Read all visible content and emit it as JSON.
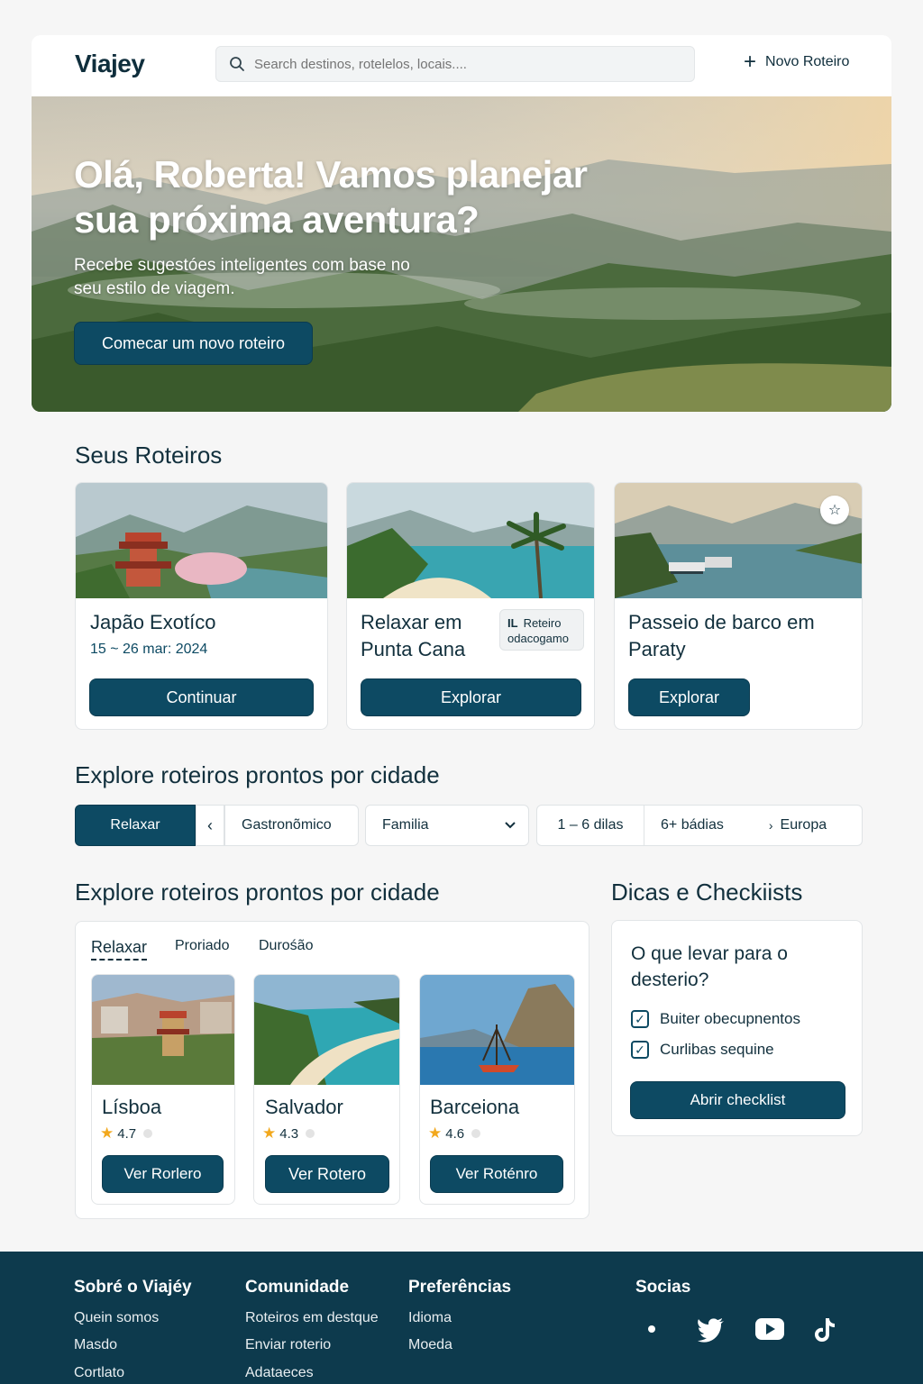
{
  "header": {
    "logo": "Viajey",
    "search_placeholder": "Search destinos, rotelelos, locais....",
    "new_trip": "Novo Roteiro"
  },
  "hero": {
    "title": "Olá, Roberta! Vamos planejar sua próxima aventura?",
    "subtitle": "Recebe sugestóes inteligentes com base no seu estilo de viagem.",
    "cta": "Comecar um novo roteiro"
  },
  "trips": {
    "heading": "Seus Roteiros",
    "items": [
      {
        "title": "Japão Exotíco",
        "date": "15 ~ 26 mar: 2024",
        "action": "Continuar"
      },
      {
        "title": "Relaxar em Punta Cana",
        "tag_line1": "Reteiro",
        "tag_line2": "odacogamo",
        "action": "Explorar"
      },
      {
        "title": "Passeio de barco em Paraty",
        "action": "Explorar"
      }
    ]
  },
  "explore": {
    "heading": "Explore roteiros prontos por cidade",
    "filters": {
      "relax": "Relaxar",
      "prev": "‹",
      "gastro": "Gastronõmico",
      "family": "Familia",
      "days_short": "1 – 6 dilas",
      "days_long": "6+ bádias",
      "region": "Europa"
    }
  },
  "cities": {
    "heading": "Explore roteiros prontos por cidade",
    "tabs": [
      "Relaxar",
      "Proriado",
      "Durośão"
    ],
    "items": [
      {
        "name": "Lísboa",
        "rating": "4.7",
        "action": "Ver Rorlero"
      },
      {
        "name": "Salvador",
        "rating": "4.3",
        "action": "Ver Rotero"
      },
      {
        "name": "Barceiona",
        "rating": "4.6",
        "action": "Ver Roténro"
      }
    ]
  },
  "tips": {
    "heading": "Dicas e Checkiists",
    "question": "O que levar para o desterio?",
    "items": [
      "Buiter obecupnentos",
      "Curlibas sequine"
    ],
    "action": "Abrir checklist"
  },
  "footer": {
    "col1": {
      "title": "Sobré o Viajéy",
      "links": [
        "Quein somos",
        "Masdo",
        "Cortlato"
      ]
    },
    "col2": {
      "title": "Comunidade",
      "links": [
        "Roteiros em destque",
        "Enviar roterio",
        "Adataeces"
      ]
    },
    "col3": {
      "title": "Preferências",
      "links": [
        "Idioma",
        "Moeda"
      ]
    },
    "col4": {
      "title": "Socias"
    }
  },
  "colors": {
    "primary": "#0d4a63",
    "footer": "#0d3a4d",
    "star": "#f2a81d"
  }
}
